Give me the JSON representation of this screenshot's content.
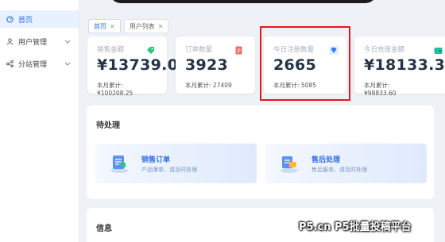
{
  "sidebar": {
    "items": [
      {
        "label": "首页",
        "icon": "dashboard-icon"
      },
      {
        "label": "用户管理",
        "icon": "user-icon"
      },
      {
        "label": "分站管理",
        "icon": "share-icon"
      }
    ]
  },
  "tabs": [
    {
      "label": "首页"
    },
    {
      "label": "用户列表"
    }
  ],
  "cards": [
    {
      "label": "销售金额",
      "value": "¥13739.09",
      "month_label": "本月累计:",
      "month_value": "¥100208.25",
      "badge_color": "#2fc37a",
      "icon": "tag-icon"
    },
    {
      "label": "订单数量",
      "value": "3923",
      "month_label": "本月累计:",
      "month_value": "27409",
      "badge_color": "#f06b6b",
      "icon": "document-icon"
    },
    {
      "label": "今日注册数量",
      "value": "2665",
      "month_label": "本月累计:",
      "month_value": "5085",
      "badge_color": "#2f7df0",
      "icon": "diamond-icon"
    },
    {
      "label": "今日充值金额",
      "value": "¥18133.33",
      "month_label": "本月累计:",
      "month_value": "¥98833.60",
      "badge_color": "#1fbfa5",
      "icon": "wallet-icon"
    }
  ],
  "todo": {
    "title": "待处理",
    "items": [
      {
        "title": "销售订单",
        "desc": "产品爆单、请及时处理"
      },
      {
        "title": "售后处理",
        "desc": "售后服务、请及时处理"
      }
    ]
  },
  "info": {
    "title": "信息"
  },
  "watermark": "P5.cn P5批量投稿平台"
}
